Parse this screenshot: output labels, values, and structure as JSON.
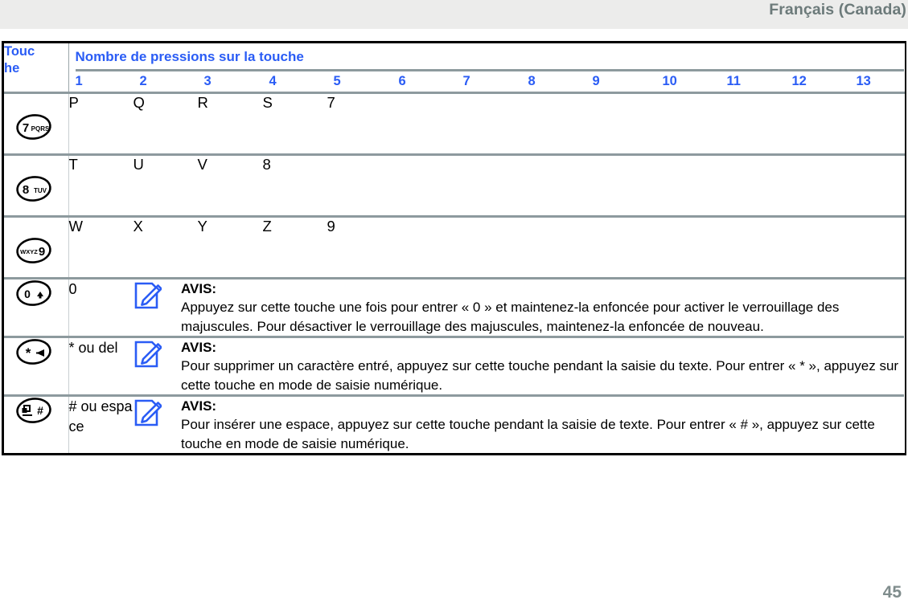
{
  "header": {
    "language_label": "Français (Canada)"
  },
  "footer": {
    "page_number": "45"
  },
  "table": {
    "key_column_header": "Touche",
    "presses_header": "Nombre de pressions sur la touche",
    "press_counts": [
      "1",
      "2",
      "3",
      "4",
      "5",
      "6",
      "7",
      "8",
      "9",
      "10",
      "11",
      "12",
      "13"
    ],
    "letter_rows": [
      {
        "key_icon": "key-7-pqrs-icon",
        "key_icon_number": "7",
        "key_icon_letters": "PQRS",
        "values": [
          "P",
          "Q",
          "R",
          "S",
          "7",
          "",
          "",
          "",
          "",
          "",
          "",
          "",
          ""
        ]
      },
      {
        "key_icon": "key-8-tuv-icon",
        "key_icon_number": "8",
        "key_icon_letters": "TUV",
        "values": [
          "T",
          "U",
          "V",
          "8",
          "",
          "",
          "",
          "",
          "",
          "",
          "",
          "",
          ""
        ]
      },
      {
        "key_icon": "key-9-wxyz-icon",
        "key_icon_number": "9",
        "key_icon_letters": "WXYZ",
        "values": [
          "W",
          "X",
          "Y",
          "Z",
          "9",
          "",
          "",
          "",
          "",
          "",
          "",
          "",
          ""
        ]
      }
    ],
    "note_rows": [
      {
        "key_icon": "key-0-shift-icon",
        "key_icon_number": "0",
        "label": "0",
        "note_title": "AVIS:",
        "note_text": "Appuyez sur cette touche une fois pour entrer « 0 » et maintenez-la enfoncée pour activer le verrouillage des majuscules. Pour désactiver le verrouillage des majuscules, maintenez-la enfoncée de nouveau."
      },
      {
        "key_icon": "key-star-delete-icon",
        "key_icon_number": "*",
        "label": "* ou del",
        "note_title": "AVIS:",
        "note_text": "Pour supprimer un caractère entré, appuyez sur cette touche pendant la saisie du texte. Pour entrer « * », appuyez sur cette touche en mode de saisie numérique."
      },
      {
        "key_icon": "key-hash-space-icon",
        "key_icon_number": "#",
        "label": "# ou espace",
        "note_title": "AVIS:",
        "note_text": "Pour insérer une espace, appuyez sur cette touche pendant la saisie de texte. Pour entrer « # », appuyez sur cette touche en mode de saisie numérique."
      }
    ],
    "note_icon_name": "note-pencil-icon"
  },
  "colors": {
    "accent_blue": "#2a5cf5",
    "header_band": "#ececeb",
    "header_text_gray": "#6c7a7a",
    "rule_gray": "#8d9a9e",
    "border_black": "#000000",
    "page_number_gray": "#7f8c8c"
  }
}
